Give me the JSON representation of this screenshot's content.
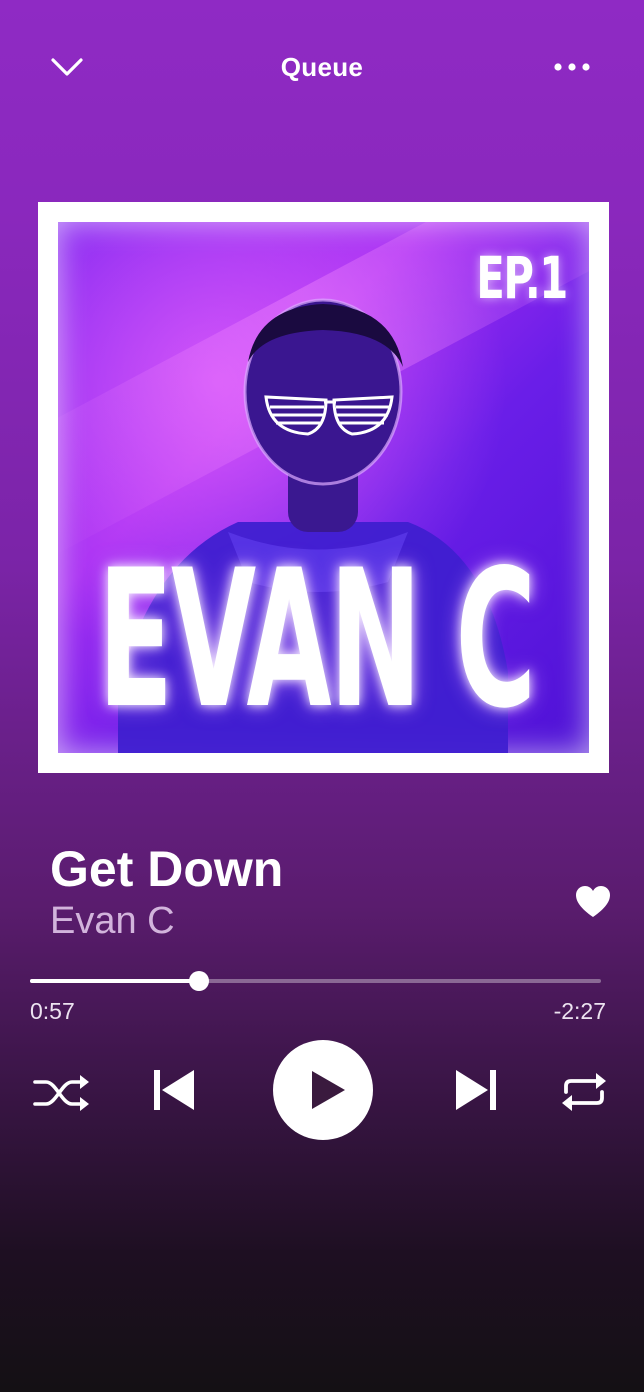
{
  "header": {
    "title": "Queue",
    "left_icon": "chevron-down-icon",
    "right_icon": "more-options-icon"
  },
  "album_art": {
    "badge_text": "EP.1",
    "artist_text": "EVAN C"
  },
  "track": {
    "title": "Get Down",
    "artist": "Evan C",
    "liked": true
  },
  "playback": {
    "elapsed": "0:57",
    "remaining": "-2:27",
    "progress_fraction": 0.296,
    "state": "paused"
  },
  "controls": {
    "shuffle_icon": "shuffle-icon",
    "previous_icon": "skip-previous-icon",
    "play_icon": "play-icon",
    "next_icon": "skip-next-icon",
    "repeat_icon": "repeat-icon"
  },
  "colors": {
    "background_top": "#8f2ac4",
    "background_bottom": "#141014",
    "accent": "#ffffff",
    "artist_text": "#d2b4dc"
  }
}
